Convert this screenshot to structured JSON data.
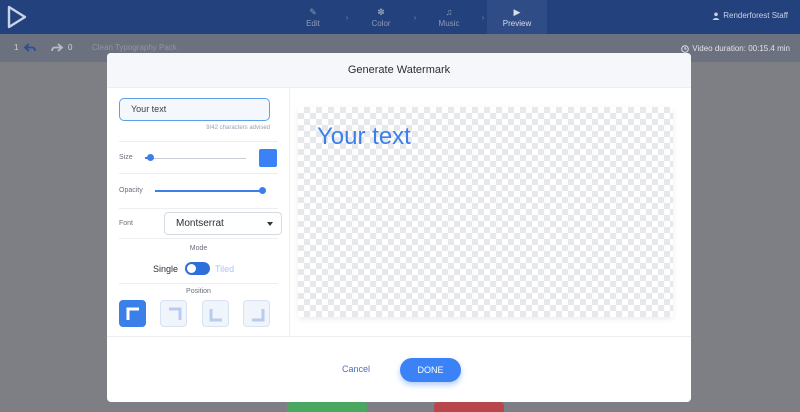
{
  "app": {
    "steps": [
      {
        "label": "Edit",
        "icon": "pencil-icon"
      },
      {
        "label": "Color",
        "icon": "palette-icon"
      },
      {
        "label": "Music",
        "icon": "music-icon"
      },
      {
        "label": "Preview",
        "icon": "play-icon"
      }
    ],
    "user_name": "Renderforest Staff"
  },
  "toolbar": {
    "undo_count": "1",
    "redo_count": "0",
    "project_name": "Clean Typography Pack",
    "duration_text": "Video duration: 00:15.4 min"
  },
  "modal": {
    "title": "Generate Watermark",
    "text_value": "Your text",
    "chars_advised": "9/42 characters advised",
    "size_label": "Size",
    "size_level": 0.05,
    "opacity_label": "Opacity",
    "opacity_level": 1.0,
    "color": "#3b82f6",
    "font_label": "Font",
    "font_value": "Montserrat",
    "mode_label": "Mode",
    "mode_single": "Single",
    "mode_tiled": "Tiled",
    "position_label": "Position",
    "preview_text": "Your text",
    "cancel_label": "Cancel",
    "done_label": "DONE"
  },
  "colors": {
    "accent": "#3b82f6",
    "topbar": "#23417d"
  }
}
